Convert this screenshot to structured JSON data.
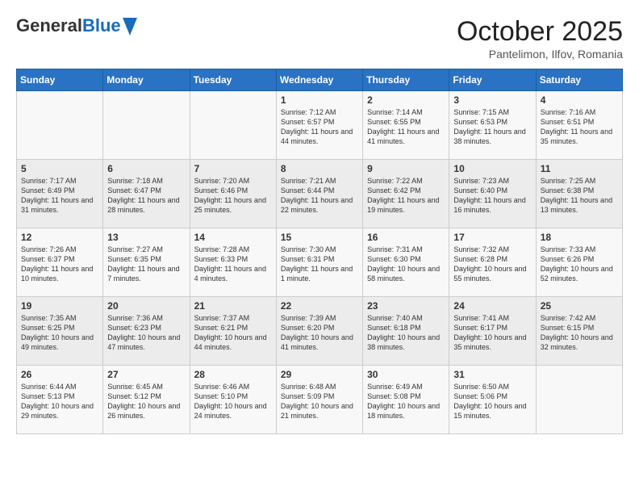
{
  "header": {
    "logo_general": "General",
    "logo_blue": "Blue",
    "month_title": "October 2025",
    "subtitle": "Pantelimon, Ilfov, Romania"
  },
  "days_of_week": [
    "Sunday",
    "Monday",
    "Tuesday",
    "Wednesday",
    "Thursday",
    "Friday",
    "Saturday"
  ],
  "weeks": [
    [
      {
        "day": "",
        "text": ""
      },
      {
        "day": "",
        "text": ""
      },
      {
        "day": "",
        "text": ""
      },
      {
        "day": "1",
        "text": "Sunrise: 7:12 AM\nSunset: 6:57 PM\nDaylight: 11 hours and 44 minutes."
      },
      {
        "day": "2",
        "text": "Sunrise: 7:14 AM\nSunset: 6:55 PM\nDaylight: 11 hours and 41 minutes."
      },
      {
        "day": "3",
        "text": "Sunrise: 7:15 AM\nSunset: 6:53 PM\nDaylight: 11 hours and 38 minutes."
      },
      {
        "day": "4",
        "text": "Sunrise: 7:16 AM\nSunset: 6:51 PM\nDaylight: 11 hours and 35 minutes."
      }
    ],
    [
      {
        "day": "5",
        "text": "Sunrise: 7:17 AM\nSunset: 6:49 PM\nDaylight: 11 hours and 31 minutes."
      },
      {
        "day": "6",
        "text": "Sunrise: 7:18 AM\nSunset: 6:47 PM\nDaylight: 11 hours and 28 minutes."
      },
      {
        "day": "7",
        "text": "Sunrise: 7:20 AM\nSunset: 6:46 PM\nDaylight: 11 hours and 25 minutes."
      },
      {
        "day": "8",
        "text": "Sunrise: 7:21 AM\nSunset: 6:44 PM\nDaylight: 11 hours and 22 minutes."
      },
      {
        "day": "9",
        "text": "Sunrise: 7:22 AM\nSunset: 6:42 PM\nDaylight: 11 hours and 19 minutes."
      },
      {
        "day": "10",
        "text": "Sunrise: 7:23 AM\nSunset: 6:40 PM\nDaylight: 11 hours and 16 minutes."
      },
      {
        "day": "11",
        "text": "Sunrise: 7:25 AM\nSunset: 6:38 PM\nDaylight: 11 hours and 13 minutes."
      }
    ],
    [
      {
        "day": "12",
        "text": "Sunrise: 7:26 AM\nSunset: 6:37 PM\nDaylight: 11 hours and 10 minutes."
      },
      {
        "day": "13",
        "text": "Sunrise: 7:27 AM\nSunset: 6:35 PM\nDaylight: 11 hours and 7 minutes."
      },
      {
        "day": "14",
        "text": "Sunrise: 7:28 AM\nSunset: 6:33 PM\nDaylight: 11 hours and 4 minutes."
      },
      {
        "day": "15",
        "text": "Sunrise: 7:30 AM\nSunset: 6:31 PM\nDaylight: 11 hours and 1 minute."
      },
      {
        "day": "16",
        "text": "Sunrise: 7:31 AM\nSunset: 6:30 PM\nDaylight: 10 hours and 58 minutes."
      },
      {
        "day": "17",
        "text": "Sunrise: 7:32 AM\nSunset: 6:28 PM\nDaylight: 10 hours and 55 minutes."
      },
      {
        "day": "18",
        "text": "Sunrise: 7:33 AM\nSunset: 6:26 PM\nDaylight: 10 hours and 52 minutes."
      }
    ],
    [
      {
        "day": "19",
        "text": "Sunrise: 7:35 AM\nSunset: 6:25 PM\nDaylight: 10 hours and 49 minutes."
      },
      {
        "day": "20",
        "text": "Sunrise: 7:36 AM\nSunset: 6:23 PM\nDaylight: 10 hours and 47 minutes."
      },
      {
        "day": "21",
        "text": "Sunrise: 7:37 AM\nSunset: 6:21 PM\nDaylight: 10 hours and 44 minutes."
      },
      {
        "day": "22",
        "text": "Sunrise: 7:39 AM\nSunset: 6:20 PM\nDaylight: 10 hours and 41 minutes."
      },
      {
        "day": "23",
        "text": "Sunrise: 7:40 AM\nSunset: 6:18 PM\nDaylight: 10 hours and 38 minutes."
      },
      {
        "day": "24",
        "text": "Sunrise: 7:41 AM\nSunset: 6:17 PM\nDaylight: 10 hours and 35 minutes."
      },
      {
        "day": "25",
        "text": "Sunrise: 7:42 AM\nSunset: 6:15 PM\nDaylight: 10 hours and 32 minutes."
      }
    ],
    [
      {
        "day": "26",
        "text": "Sunrise: 6:44 AM\nSunset: 5:13 PM\nDaylight: 10 hours and 29 minutes."
      },
      {
        "day": "27",
        "text": "Sunrise: 6:45 AM\nSunset: 5:12 PM\nDaylight: 10 hours and 26 minutes."
      },
      {
        "day": "28",
        "text": "Sunrise: 6:46 AM\nSunset: 5:10 PM\nDaylight: 10 hours and 24 minutes."
      },
      {
        "day": "29",
        "text": "Sunrise: 6:48 AM\nSunset: 5:09 PM\nDaylight: 10 hours and 21 minutes."
      },
      {
        "day": "30",
        "text": "Sunrise: 6:49 AM\nSunset: 5:08 PM\nDaylight: 10 hours and 18 minutes."
      },
      {
        "day": "31",
        "text": "Sunrise: 6:50 AM\nSunset: 5:06 PM\nDaylight: 10 hours and 15 minutes."
      },
      {
        "day": "",
        "text": ""
      }
    ]
  ]
}
